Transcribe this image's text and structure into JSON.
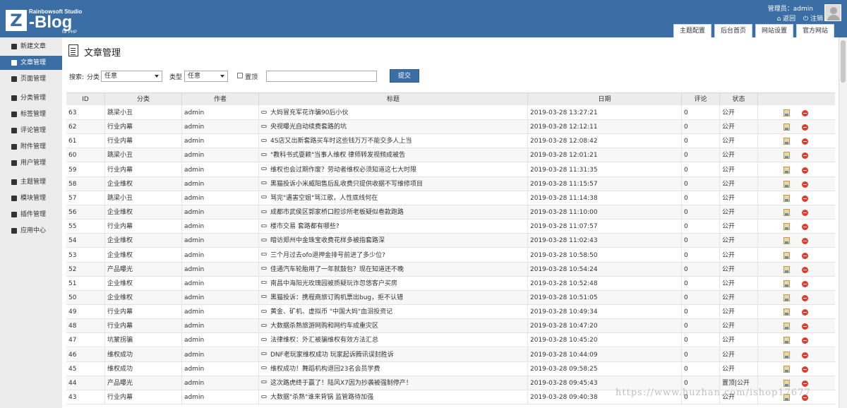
{
  "header": {
    "logo_studio": "Rainbowsoft Studio",
    "logo_letter": "Z",
    "logo_name": "-Blog",
    "logo_sub": "for PHP",
    "admin_label": "管理员：admin",
    "back_link": "⌂ 返回",
    "logout_link": "⏻ 注销",
    "tabs": [
      "主题配置",
      "后台首页",
      "网站设置",
      "官方网站"
    ]
  },
  "sidebar": {
    "items": [
      {
        "label": "新建文章",
        "icon": "edit-icon"
      },
      {
        "label": "文章管理",
        "icon": "file-icon",
        "active": true
      },
      {
        "label": "页面管理",
        "icon": "page-icon"
      },
      {
        "label": "分类管理",
        "icon": "folder-icon"
      },
      {
        "label": "标签管理",
        "icon": "tag-icon"
      },
      {
        "label": "评论管理",
        "icon": "comment-icon"
      },
      {
        "label": "附件管理",
        "icon": "attachment-icon"
      },
      {
        "label": "用户管理",
        "icon": "user-icon"
      },
      {
        "label": "主题管理",
        "icon": "theme-icon"
      },
      {
        "label": "模块管理",
        "icon": "module-icon"
      },
      {
        "label": "插件管理",
        "icon": "plugin-icon"
      },
      {
        "label": "应用中心",
        "icon": "app-center-icon"
      }
    ]
  },
  "main": {
    "title": "文章管理",
    "search": {
      "search_label": "搜索:",
      "category_label": "分类",
      "category_value": "任意",
      "type_label": "类型",
      "type_value": "任意",
      "top_label": "置顶",
      "keyword_value": "",
      "submit_label": "提交"
    },
    "table": {
      "headers": [
        "ID",
        "分类",
        "作者",
        "标题",
        "日期",
        "评论",
        "状态",
        ""
      ],
      "rows": [
        {
          "id": "63",
          "category": "跳梁小丑",
          "author": "admin",
          "title": "大妈冒充军花诈骗90后小伙",
          "date": "2019-03-28 13:27:21",
          "comments": "0",
          "status": "公开"
        },
        {
          "id": "62",
          "category": "行业内幕",
          "author": "admin",
          "title": "央视曝光自动续费套路的坑",
          "date": "2019-03-28 12:12:11",
          "comments": "0",
          "status": "公开"
        },
        {
          "id": "61",
          "category": "行业内幕",
          "author": "admin",
          "title": "4S店又出新套路买车时这些钱万万不能交多人上当",
          "date": "2019-03-28 12:08:42",
          "comments": "0",
          "status": "公开"
        },
        {
          "id": "60",
          "category": "跳梁小丑",
          "author": "admin",
          "title": "\"教科书式耍赖\"当事人维权 律师转发视频成被告",
          "date": "2019-03-28 12:01:21",
          "comments": "0",
          "status": "公开"
        },
        {
          "id": "59",
          "category": "行业内幕",
          "author": "admin",
          "title": "维权也会过期作废？劳动者维权必须知道这七大时限",
          "date": "2019-03-28 11:31:35",
          "comments": "0",
          "status": "公开"
        },
        {
          "id": "58",
          "category": "企业维权",
          "author": "admin",
          "title": "黑猫投诉小米威阳售后乱收费只提供收据不写维修项目",
          "date": "2019-03-28 11:15:57",
          "comments": "0",
          "status": "公开"
        },
        {
          "id": "57",
          "category": "跳梁小丑",
          "author": "admin",
          "title": "骂完\"遇害空姐\"骂江歌，人性底线何在",
          "date": "2019-03-28 11:14:38",
          "comments": "0",
          "status": "公开"
        },
        {
          "id": "56",
          "category": "企业维权",
          "author": "admin",
          "title": "成都市武侯区郭家桥口腔诊所老板疑似卷款跑路",
          "date": "2019-03-28 11:10:00",
          "comments": "0",
          "status": "公开"
        },
        {
          "id": "55",
          "category": "行业内幕",
          "author": "admin",
          "title": "楼市交易 套路都有哪些?",
          "date": "2019-03-28 11:07:57",
          "comments": "0",
          "status": "公开"
        },
        {
          "id": "54",
          "category": "企业维权",
          "author": "admin",
          "title": "暗访郑州中金珠宝收费花样多被指套路深",
          "date": "2019-03-28 11:02:43",
          "comments": "0",
          "status": "公开"
        },
        {
          "id": "53",
          "category": "企业维权",
          "author": "admin",
          "title": "三个月过去ofo退押金排号前进了多少位?",
          "date": "2019-03-28 10:58:50",
          "comments": "0",
          "status": "公开"
        },
        {
          "id": "52",
          "category": "产品曝光",
          "author": "admin",
          "title": "佳通汽车轮胎用了一年就鼓包？现在知道还不晚",
          "date": "2019-03-28 10:54:24",
          "comments": "0",
          "status": "公开"
        },
        {
          "id": "51",
          "category": "企业维权",
          "author": "admin",
          "title": "南昌中海阳光玫瑰园被质疑玩诈忽悠客户买房",
          "date": "2019-03-28 10:52:48",
          "comments": "0",
          "status": "公开"
        },
        {
          "id": "50",
          "category": "企业维权",
          "author": "admin",
          "title": "黑猫投诉：携程商旅订购机票出bug，拒不认错",
          "date": "2019-03-28 10:51:05",
          "comments": "0",
          "status": "公开"
        },
        {
          "id": "49",
          "category": "行业内幕",
          "author": "admin",
          "title": "黄金、矿机、虚拟币 \"中国大妈\"血泪投资记",
          "date": "2019-03-28 10:49:34",
          "comments": "0",
          "status": "公开"
        },
        {
          "id": "48",
          "category": "行业内幕",
          "author": "admin",
          "title": "大数据杀熟旅游网购和网约车成重灾区",
          "date": "2019-03-28 10:47:20",
          "comments": "0",
          "status": "公开"
        },
        {
          "id": "47",
          "category": "坑蒙拐骗",
          "author": "admin",
          "title": "法律维权：外汇被骗维权有效方法汇总",
          "date": "2019-03-28 10:45:20",
          "comments": "0",
          "status": "公开"
        },
        {
          "id": "46",
          "category": "维权成功",
          "author": "admin",
          "title": "DNF老玩家维权成功 玩家起诉腾讯误封胜诉",
          "date": "2019-03-28 10:44:09",
          "comments": "0",
          "status": "公开"
        },
        {
          "id": "45",
          "category": "维权成功",
          "author": "admin",
          "title": "维权成功！舞蹈机构退回23名会员学费",
          "date": "2019-03-28 09:58:25",
          "comments": "0",
          "status": "公开"
        },
        {
          "id": "44",
          "category": "产品曝光",
          "author": "admin",
          "title": "这次路虎终于赢了！陆风X7因为抄袭被强制停产！",
          "date": "2019-03-28 09:45:43",
          "comments": "0",
          "status": "置顶|公开"
        },
        {
          "id": "43",
          "category": "行业内幕",
          "author": "admin",
          "title": "大数据\"杀熟\"谁来背锅 监管路待加强",
          "date": "2019-03-28 09:40:38",
          "comments": "0",
          "status": "公开"
        }
      ]
    }
  },
  "watermark": "https://www.huzhan.com/ishop17677",
  "colors": {
    "primary": "#3a6ea5",
    "sidebar_bg": "#ececec",
    "delete_red": "#e03a2c"
  }
}
